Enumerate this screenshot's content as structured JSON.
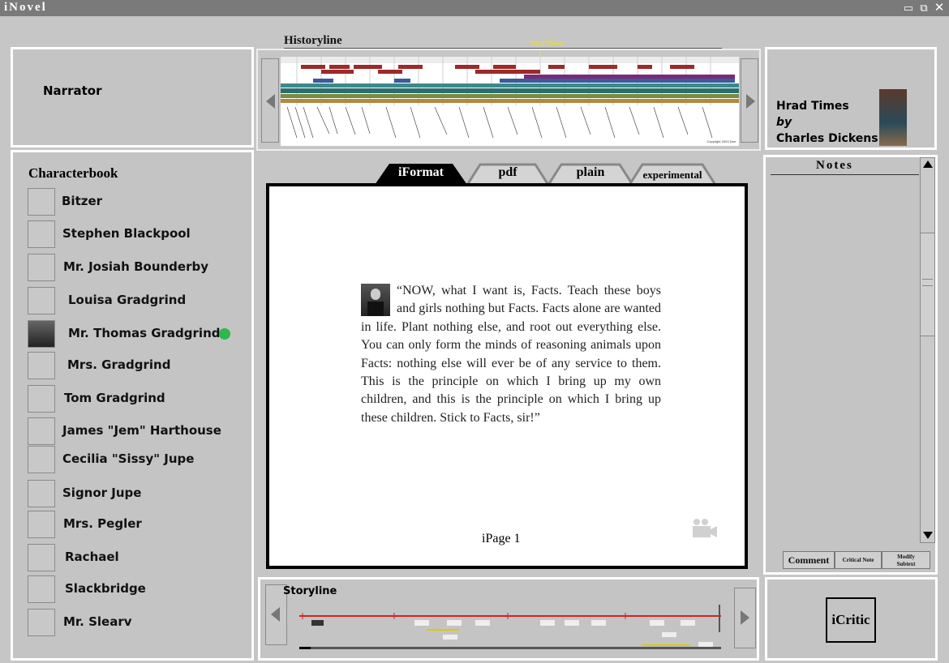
{
  "app": {
    "title": "iNovel"
  },
  "window_controls": {
    "minimize": "▭",
    "restore": "⧉",
    "close": "✕"
  },
  "narrator": {
    "label": "Narrator"
  },
  "historyline": {
    "title": "Historyline",
    "highlight": "Hard Times",
    "copyright": "Copyright 2003 Dan"
  },
  "book": {
    "title": "Hrad Times",
    "by": "by",
    "author": "Charles Dickens"
  },
  "characterbook": {
    "title": "Characterbook",
    "characters": [
      {
        "name": "Bitzer"
      },
      {
        "name": "Stephen Blackpool"
      },
      {
        "name": "Mr. Josiah Bounderby"
      },
      {
        "name": "Louisa Gradgrind"
      },
      {
        "name": "Mr. Thomas Gradgrind",
        "active": true
      },
      {
        "name": "Mrs. Gradgrind"
      },
      {
        "name": "Tom Gradgrind"
      },
      {
        "name": "James \"Jem\" Harthouse"
      },
      {
        "name": "Cecilia \"Sissy\" Jupe"
      },
      {
        "name": "Signor Jupe"
      },
      {
        "name": "Mrs. Pegler"
      },
      {
        "name": "Rachael"
      },
      {
        "name": "Slackbridge"
      },
      {
        "name": "Mr. Slearv"
      }
    ],
    "active_color": "#2fb84a"
  },
  "tabs": [
    {
      "label": "iFormat",
      "active": true
    },
    {
      "label": "pdf"
    },
    {
      "label": "plain"
    },
    {
      "label": "experimental"
    }
  ],
  "reader": {
    "passage": "“NOW, what I want is, Facts. Teach these boys and girls nothing but Facts. Facts alone are wanted in life. Plant nothing else, and root out everything else. You can only form the minds of reasoning animals upon Facts: nothing else will ever be of any service to them. This is the principle on which I bring up my own children, and this is the principle on which I bring up these children. Stick to Facts, sir!”",
    "page_label": "iPage 1",
    "media_icon": "camera-icon"
  },
  "notes": {
    "title": "Notes",
    "buttons": {
      "comment": "Comment",
      "critical": "Critical Note",
      "modify_1": "Modify",
      "modify_2": "Subtext"
    }
  },
  "storyline": {
    "title": "Storyline"
  },
  "icritic": {
    "label": "iCritic"
  }
}
